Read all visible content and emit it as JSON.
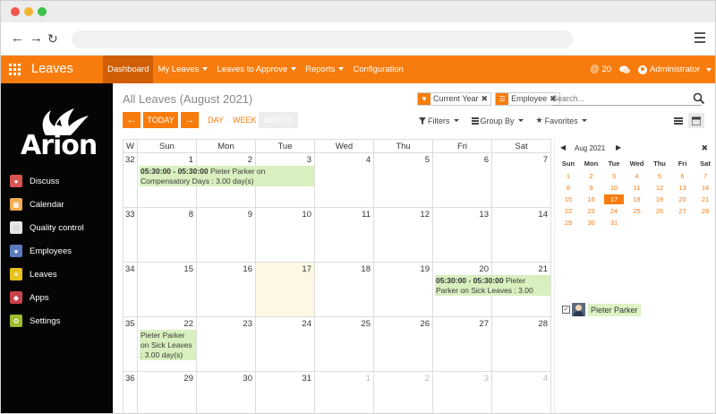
{
  "app": {
    "brand": "Leaves",
    "logo_text": "Arion"
  },
  "topnav": {
    "menu": [
      {
        "label": "Dashboard",
        "has_caret": false
      },
      {
        "label": "My Leaves",
        "has_caret": true
      },
      {
        "label": "Leaves to Approve",
        "has_caret": true
      },
      {
        "label": "Reports",
        "has_caret": true
      },
      {
        "label": "Configuration",
        "has_caret": false
      }
    ],
    "notifications_count": "20",
    "user": "Administrator"
  },
  "sidebar": {
    "items": [
      {
        "label": "Discuss",
        "icon": "chat-icon",
        "color": "#d9534f"
      },
      {
        "label": "Calendar",
        "icon": "calendar-icon",
        "color": "#f0ad4e"
      },
      {
        "label": "Quality control",
        "icon": "quality-icon",
        "color": "#e6e6e6"
      },
      {
        "label": "Employees",
        "icon": "employees-icon",
        "color": "#5b7bc0"
      },
      {
        "label": "Leaves",
        "icon": "leaves-icon",
        "color": "#e8c21c"
      },
      {
        "label": "Apps",
        "icon": "apps-icon",
        "color": "#c9414a"
      },
      {
        "label": "Settings",
        "icon": "settings-icon",
        "color": "#9cbb2e"
      }
    ]
  },
  "page": {
    "title": "All Leaves (August 2021)",
    "facets": [
      {
        "label": "Current Year",
        "icon": "filter-icon"
      },
      {
        "label": "Employee",
        "icon": "group-icon"
      }
    ],
    "search_placeholder": "Search...",
    "today_label": "TODAY",
    "modes": [
      "DAY",
      "WEEK",
      "MONTH"
    ],
    "filters": [
      "Filters",
      "Group By",
      "Favorites"
    ]
  },
  "calendar": {
    "header": [
      "W",
      "Sun",
      "Mon",
      "Tue",
      "Wed",
      "Thu",
      "Fri",
      "Sat"
    ],
    "weeks": [
      {
        "num": "32",
        "days": [
          "1",
          "2",
          "3",
          "4",
          "5",
          "6",
          "7"
        ]
      },
      {
        "num": "33",
        "days": [
          "8",
          "9",
          "10",
          "11",
          "12",
          "13",
          "14"
        ]
      },
      {
        "num": "34",
        "days": [
          "15",
          "16",
          "17",
          "18",
          "19",
          "20",
          "21"
        ]
      },
      {
        "num": "35",
        "days": [
          "22",
          "23",
          "24",
          "25",
          "26",
          "27",
          "28"
        ]
      },
      {
        "num": "36",
        "days": [
          "29",
          "30",
          "31",
          "1",
          "2",
          "3",
          "4"
        ]
      }
    ],
    "events": [
      {
        "week": 0,
        "start": 0,
        "span": 3,
        "bold": "05:30:00 - 05:30:00",
        "text": " Pieter Parker on Compensatory Days : 3.00 day(s)"
      },
      {
        "week": 2,
        "start": 5,
        "span": 2,
        "bold": "05:30:00 - 05:30:00",
        "text": " Pieter Parker on Sick Leaves : 3.00 day(s)"
      },
      {
        "week": 3,
        "start": 0,
        "span": 1,
        "bold": "",
        "text": "Pieter Parker on Sick Leaves : 3.00 day(s)"
      }
    ]
  },
  "mini_calendar": {
    "title": "Aug 2021",
    "dow": [
      "Sun",
      "Mon",
      "Tue",
      "Wed",
      "Thu",
      "Fri",
      "Sat"
    ],
    "weeks": [
      [
        "1",
        "2",
        "3",
        "4",
        "5",
        "6",
        "7"
      ],
      [
        "8",
        "9",
        "10",
        "11",
        "12",
        "13",
        "14"
      ],
      [
        "15",
        "16",
        "17",
        "18",
        "19",
        "20",
        "21"
      ],
      [
        "22",
        "23",
        "24",
        "25",
        "26",
        "27",
        "28"
      ],
      [
        "29",
        "30",
        "31",
        "",
        "",
        "",
        ""
      ]
    ],
    "selected": "17"
  },
  "attendees": [
    {
      "name": "Pieter Parker",
      "checked": true
    }
  ],
  "colors": {
    "brand": "#f87c0d",
    "event_bg": "#d8f0bf",
    "today_bg": "#fcf8e3"
  }
}
